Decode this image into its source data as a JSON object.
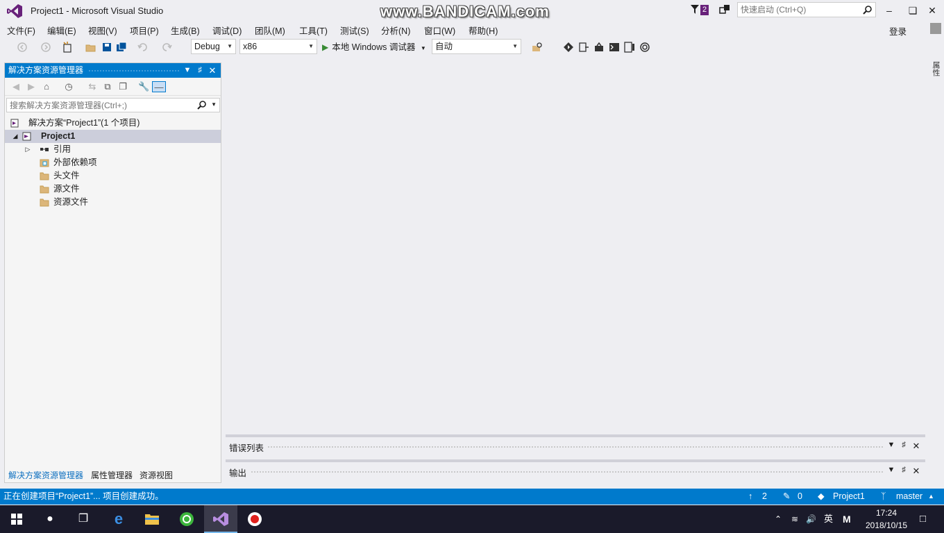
{
  "window": {
    "title": "Project1 - Microsoft Visual Studio",
    "watermark": "www.BANDICAM.com",
    "notification_count": "2",
    "quicklaunch_placeholder": "快速启动 (Ctrl+Q)",
    "signin_label": "登录"
  },
  "menu": [
    "文件(F)",
    "编辑(E)",
    "视图(V)",
    "项目(P)",
    "生成(B)",
    "调试(D)",
    "团队(M)",
    "工具(T)",
    "测试(S)",
    "分析(N)",
    "窗口(W)",
    "帮助(H)"
  ],
  "toolbar": {
    "config": "Debug",
    "platform": "x86",
    "run_label": "本地 Windows 调试器",
    "mode": "自动"
  },
  "solution_explorer": {
    "title": "解决方案资源管理器",
    "search_placeholder": "搜索解决方案资源管理器(Ctrl+;)",
    "tree": [
      {
        "label": "解决方案“Project1”(1 个项目)"
      },
      {
        "label": "Project1"
      },
      {
        "label": "引用"
      },
      {
        "label": "外部依赖项"
      },
      {
        "label": "头文件"
      },
      {
        "label": "源文件"
      },
      {
        "label": "资源文件"
      }
    ],
    "tabs": [
      "解决方案资源管理器",
      "属性管理器",
      "资源视图"
    ]
  },
  "side_tab": "属性",
  "panels": {
    "error_list": "错误列表",
    "output": "输出"
  },
  "statusbar": {
    "message": "正在创建项目“Project1”... 项目创建成功。",
    "up_count": "2",
    "pending_count": "0",
    "project": "Project1",
    "branch": "master"
  },
  "taskbar": {
    "ime": "英",
    "ime_mode": "M",
    "time": "17:24",
    "date": "2018/10/15"
  },
  "colors": {
    "accent": "#007acc",
    "vs_purple": "#68217a",
    "selected_row": "#cccedb"
  }
}
